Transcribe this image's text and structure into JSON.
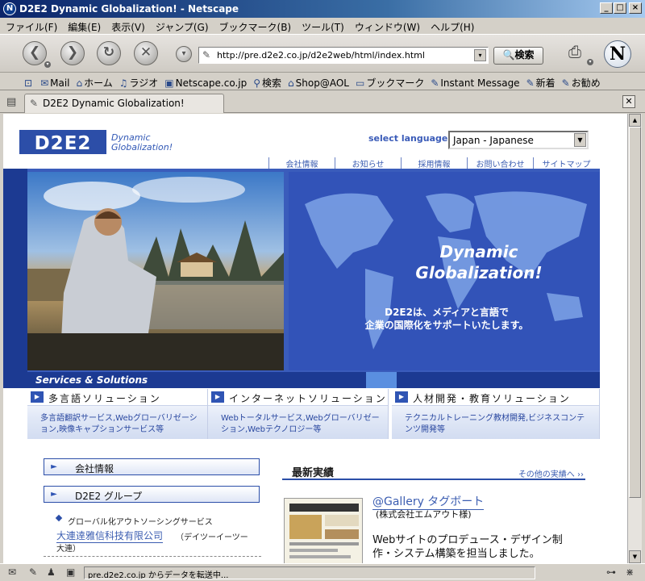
{
  "window": {
    "title": "D2E2 Dynamic Globalization! - Netscape",
    "app_icon": "N"
  },
  "menubar": [
    "ファイル(F)",
    "編集(E)",
    "表示(V)",
    "ジャンプ(G)",
    "ブックマーク(B)",
    "ツール(T)",
    "ウィンドウ(W)",
    "ヘルプ(H)"
  ],
  "navbar": {
    "url": "http://pre.d2e2.co.jp/d2e2web/html/index.html",
    "search_label": "検索",
    "logo_letter": "N"
  },
  "personal_toolbar": [
    {
      "label": "Mail",
      "icon": "mail-icon"
    },
    {
      "label": "ホーム",
      "icon": "home-icon"
    },
    {
      "label": "ラジオ",
      "icon": "radio-icon"
    },
    {
      "label": "Netscape.co.jp",
      "icon": "netscape-icon"
    },
    {
      "label": "検索",
      "icon": "search-icon"
    },
    {
      "label": "Shop@AOL",
      "icon": "shop-icon"
    },
    {
      "label": "ブックマーク",
      "icon": "bookmark-icon"
    },
    {
      "label": "Instant Message",
      "icon": "im-icon"
    },
    {
      "label": "新着",
      "icon": "new-icon"
    },
    {
      "label": "お勧め",
      "icon": "recommend-icon"
    }
  ],
  "tab": {
    "title": "D2E2 Dynamic Globalization!"
  },
  "page": {
    "logo_text": "D2E2",
    "logo_tag_line1": "Dynamic",
    "logo_tag_line2": "Globalization!",
    "select_language_label": "select language",
    "language_value": "Japan - Japanese",
    "top_nav": [
      "会社情報",
      "お知らせ",
      "採用情報",
      "お問い合わせ",
      "サイトマップ"
    ],
    "hero_line1": "Dynamic",
    "hero_line2": "Globalization!",
    "hero_j1": "D2E2は、メディアと言語で",
    "hero_j2": "企業の国際化をサポートいたします。",
    "services_label": "Services & Solutions",
    "services": [
      {
        "title": "多言語ソリューション",
        "desc": "多言語翻訳サービス,Webグローバリゼーション,映像キャプションサービス等"
      },
      {
        "title": "インターネットソリューション",
        "desc": "Webトータルサービス,Webグローバリゼーション,Webテクノロジー等"
      },
      {
        "title": "人材開発・教育ソリューション",
        "desc": "テクニカルトレーニング教材開発,ビジネスコンテンツ開発等"
      }
    ],
    "left_buttons": [
      "会社情報",
      "D2E2 グループ"
    ],
    "global_service": "グローバル化アウトソーシングサービス",
    "dalian_link": "大連逹雅信科技有限公司",
    "dalian_reading": "（デイツーイーツー",
    "dalian_reading2": "大連）",
    "latest_title": "最新実績",
    "latest_more": "その他の実績へ ››",
    "gallery_title": "@Gallery タグボート",
    "gallery_company": "(株式会社エムアウト様)",
    "gallery_desc": "Webサイトのプロデュース・デザイン制作・システム構築を担当しました。"
  },
  "status": {
    "message": "pre.d2e2.co.jp からデータを転送中..."
  }
}
